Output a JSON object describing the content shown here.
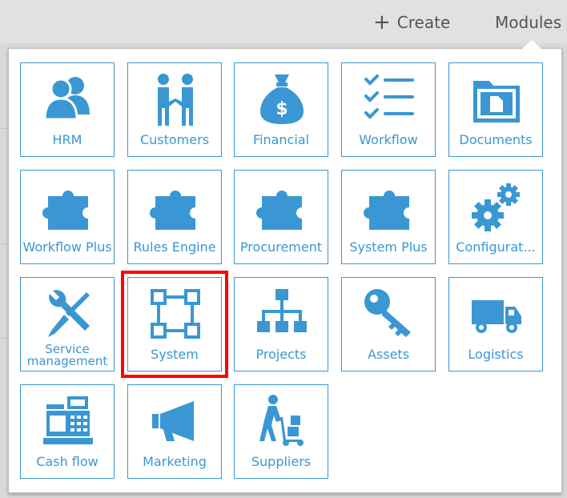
{
  "topbar": {
    "create_label": "Create",
    "modules_label": "Modules"
  },
  "modules": [
    {
      "label": "HRM",
      "icon": "people-icon"
    },
    {
      "label": "Customers",
      "icon": "handshake-icon"
    },
    {
      "label": "Financial",
      "icon": "money-bag-icon"
    },
    {
      "label": "Workflow",
      "icon": "checklist-icon"
    },
    {
      "label": "Documents",
      "icon": "folder-document-icon"
    },
    {
      "label": "Workflow Plus",
      "icon": "puzzle-icon"
    },
    {
      "label": "Rules Engine",
      "icon": "puzzle-icon"
    },
    {
      "label": "Procurement",
      "icon": "puzzle-icon"
    },
    {
      "label": "System Plus",
      "icon": "puzzle-icon"
    },
    {
      "label": "Configurat...",
      "icon": "gears-icon"
    },
    {
      "label": "Service management",
      "icon": "tools-icon"
    },
    {
      "label": "System",
      "icon": "system-network-icon",
      "selected": true
    },
    {
      "label": "Projects",
      "icon": "org-chart-icon"
    },
    {
      "label": "Assets",
      "icon": "key-icon"
    },
    {
      "label": "Logistics",
      "icon": "truck-icon"
    },
    {
      "label": "Cash flow",
      "icon": "cash-register-icon"
    },
    {
      "label": "Marketing",
      "icon": "megaphone-icon"
    },
    {
      "label": "Suppliers",
      "icon": "hand-truck-icon"
    }
  ],
  "colors": {
    "accent": "#3a97d3",
    "highlight": "#ff0000",
    "topbar_bg": "#e1e1e1"
  }
}
